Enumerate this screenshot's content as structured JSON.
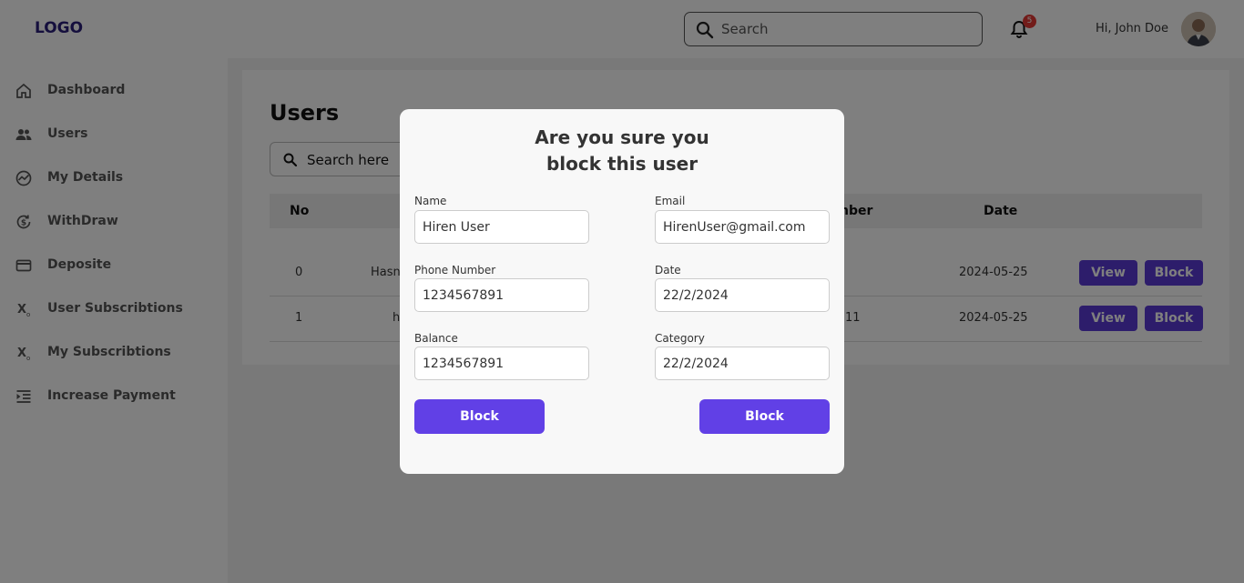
{
  "header": {
    "logo": "LOGO",
    "search_placeholder": "Search",
    "notification_count": "5",
    "greeting": "Hi, John Doe",
    "icons": {
      "search": "search-icon",
      "bell": "bell-icon",
      "avatar": "user-avatar"
    }
  },
  "sidebar": {
    "items": [
      {
        "label": "Dashboard",
        "icon": "home-icon"
      },
      {
        "label": "Users",
        "icon": "users-icon"
      },
      {
        "label": "My Details",
        "icon": "chart-icon"
      },
      {
        "label": "WithDraw",
        "icon": "withdraw-icon"
      },
      {
        "label": "Deposite",
        "icon": "card-icon"
      },
      {
        "label": "User Subscribtions",
        "icon": "subscript-icon"
      },
      {
        "label": "My Subscribtions",
        "icon": "subscript-icon"
      },
      {
        "label": "Increase Payment",
        "icon": "indent-icon"
      }
    ]
  },
  "main": {
    "title": "Users",
    "search_placeholder": "Search here",
    "columns": {
      "no": "No",
      "number_partial": "nber",
      "date": "Date"
    },
    "rows": [
      {
        "no": "0",
        "name_partial": "Hasn",
        "number_partial": "",
        "date": "2024-05-25",
        "view": "View",
        "block": "Block"
      },
      {
        "no": "1",
        "name_partial": "h",
        "number_partial": "11",
        "date": "2024-05-25",
        "view": "View",
        "block": "Block"
      }
    ]
  },
  "modal": {
    "title_line1": "Are you sure you",
    "title_line2": "block this user",
    "fields": {
      "name": {
        "label": "Name",
        "value": "Hiren User"
      },
      "email": {
        "label": "Email",
        "value": "HirenUser@gmail.com"
      },
      "phone": {
        "label": "Phone Number",
        "value": "1234567891"
      },
      "date": {
        "label": "Date",
        "value": "22/2/2024"
      },
      "balance": {
        "label": "Balance",
        "value": "1234567891"
      },
      "category": {
        "label": "Category",
        "value": "22/2/2024"
      }
    },
    "block_left": "Block",
    "block_right": "Block"
  },
  "colors": {
    "accent": "#6140e6",
    "button": "#5b3bd6",
    "badge": "#e53935",
    "logo": "#2a1f7a"
  }
}
